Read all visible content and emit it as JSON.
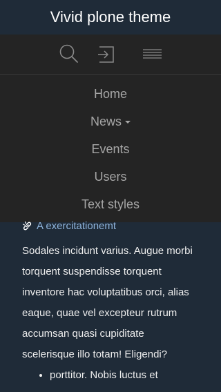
{
  "header": {
    "site_title": "Vivid plone theme"
  },
  "toolbar": {
    "items": [
      {
        "icon": "search-icon"
      },
      {
        "icon": "login-icon"
      },
      {
        "icon": "hamburger-menu-icon"
      }
    ]
  },
  "nav": {
    "items": [
      {
        "label": "Home"
      },
      {
        "label": "News",
        "has_dropdown": true
      },
      {
        "label": "Events"
      },
      {
        "label": "Users"
      },
      {
        "label": "Text styles"
      }
    ]
  },
  "content": {
    "link": {
      "icon": "external-link-icon",
      "label": "A exercitationemt"
    },
    "paragraph": "Sodales incidunt varius. Augue morbi torquent suspendisse torquent inventore hac voluptatibus orci, alias eaque, quae vel excepteur rutrum accumsan quasi cupiditate scelerisque illo totam! Eligendi?",
    "bullets": [
      "porttitor. Nobis luctus et"
    ]
  },
  "colors": {
    "header_bg": "#1f2b38",
    "menu_bg": "#242424",
    "menu_text": "#a6a6a6",
    "link": "#8fb4dc",
    "body_text": "#eeeeee"
  }
}
